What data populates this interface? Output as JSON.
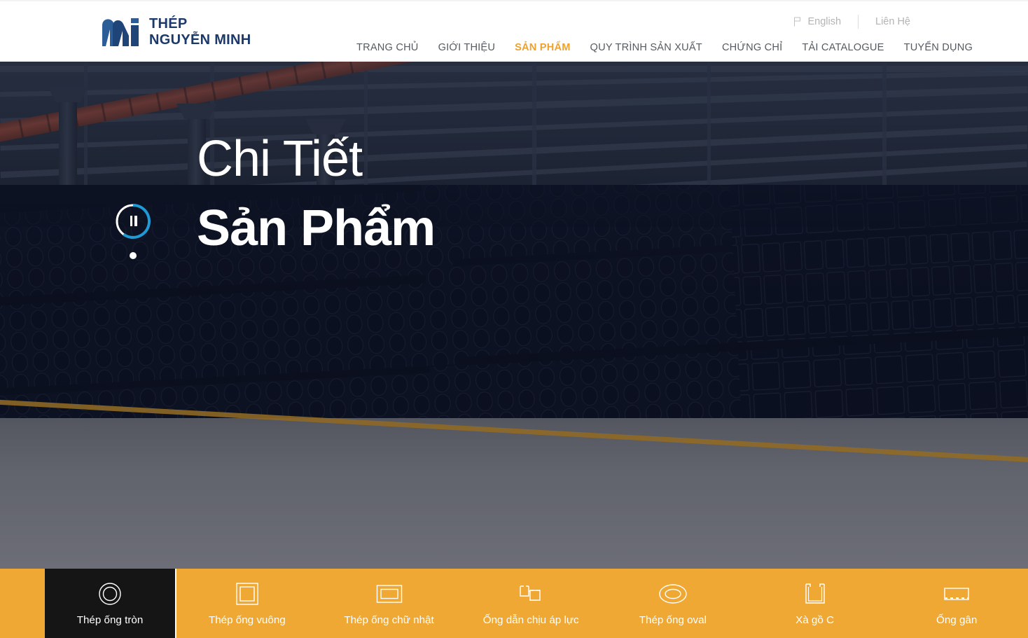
{
  "brand": {
    "logo_icon": "nguyen-minh-m-logo",
    "line1": "THÉP",
    "line2": "NGUYỄN MINH",
    "color": "#1b3a6b"
  },
  "topbar": {
    "flag_icon": "flag-icon",
    "language": "English",
    "contact": "Liên Hệ"
  },
  "nav": {
    "items": [
      {
        "label": "TRANG CHỦ",
        "active": false
      },
      {
        "label": "GIỚI THIỆU",
        "active": false
      },
      {
        "label": "SẢN PHẨM",
        "active": true
      },
      {
        "label": "QUY TRÌNH SẢN XUẤT",
        "active": false
      },
      {
        "label": "CHỨNG CHỈ",
        "active": false
      },
      {
        "label": "TẢI CATALOGUE",
        "active": false
      },
      {
        "label": "TUYỂN DỤNG",
        "active": false
      }
    ],
    "active_color": "#eda22e",
    "inactive_color": "#555b60"
  },
  "hero": {
    "title_line1": "Chi Tiết",
    "title_line2": "Sản Phẩm",
    "play_icon": "pause-icon",
    "progress_arc_color": "#1e9bd7",
    "slider_dot": "slide-indicator-dot",
    "background_description": "steel-warehouse-pipe-stacks"
  },
  "categories": {
    "bar_color": "#efa834",
    "active_bg": "#151515",
    "items": [
      {
        "label": "Thép ống tròn",
        "icon": "round-pipe-icon",
        "active": true
      },
      {
        "label": "Thép ống vuông",
        "icon": "square-tube-icon",
        "active": false
      },
      {
        "label": "Thép ống chữ nhật",
        "icon": "rectangular-tube-icon",
        "active": false
      },
      {
        "label": "Ống dẫn chịu áp lực",
        "icon": "pressure-pipe-icon",
        "active": false
      },
      {
        "label": "Thép ống oval",
        "icon": "oval-tube-icon",
        "active": false
      },
      {
        "label": "Xà gồ C",
        "icon": "c-purlin-icon",
        "active": false
      },
      {
        "label": "Ống gân",
        "icon": "ribbed-pipe-icon",
        "active": false
      }
    ]
  }
}
